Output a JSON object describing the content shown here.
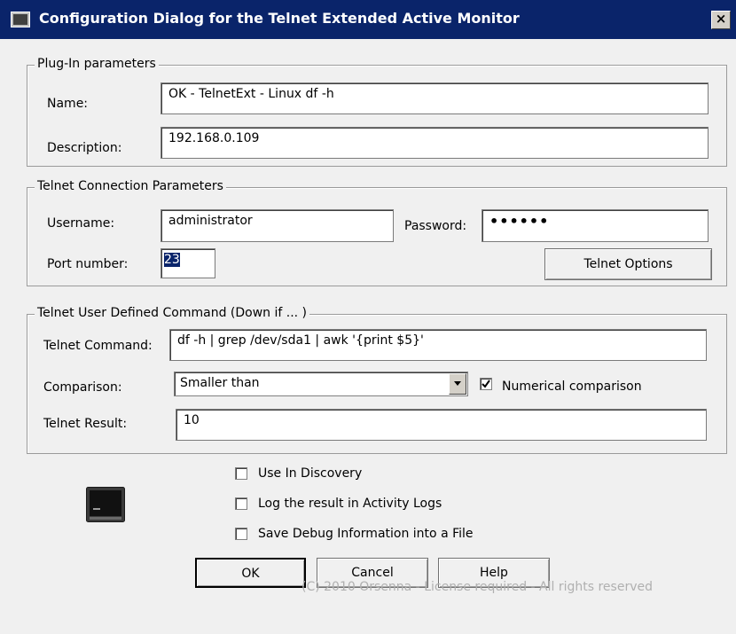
{
  "window": {
    "title": "Configuration Dialog for the Telnet Extended Active Monitor",
    "close_glyph": "×"
  },
  "plugin_params": {
    "legend": "Plug-In parameters",
    "name_label": "Name:",
    "name_value": "OK - TelnetExt - Linux df -h",
    "description_label": "Description:",
    "description_value": "192.168.0.109"
  },
  "connection": {
    "legend": "Telnet Connection Parameters",
    "username_label": "Username:",
    "username_value": "administrator",
    "password_label": "Password:",
    "password_value": "••••••",
    "port_label": "Port number:",
    "port_value": "23",
    "options_button": "Telnet Options"
  },
  "command": {
    "legend": "Telnet User Defined Command (Down if ... )",
    "command_label": "Telnet Command:",
    "command_value": "df -h | grep /dev/sda1 | awk '{print $5}'",
    "comparison_label": "Comparison:",
    "comparison_value": "Smaller than",
    "numerical_label": "Numerical comparison",
    "numerical_checked": true,
    "result_label": "Telnet Result:",
    "result_value": "10"
  },
  "options": {
    "use_in_discovery": "Use In Discovery",
    "log_result": "Log the result in Activity Logs",
    "save_debug": "Save Debug Information into a File"
  },
  "buttons": {
    "ok": "OK",
    "cancel": "Cancel",
    "help": "Help"
  },
  "footer": "(C) 2010 Orsenna - License required - All rights reserved",
  "colors": {
    "titlebar": "#0a246a",
    "dialog_bg": "#f0f0f0",
    "selection": "#0a246a"
  }
}
